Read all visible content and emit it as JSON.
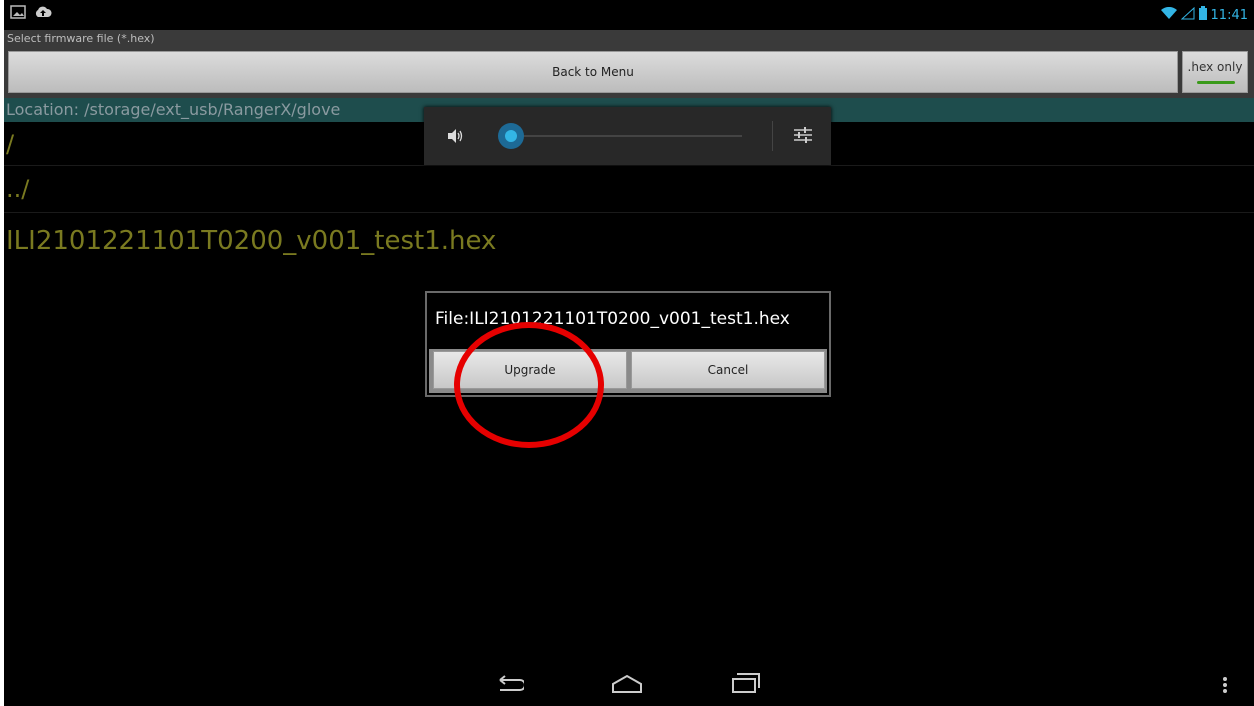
{
  "status_bar": {
    "time": "11:41",
    "left_icons": [
      "gallery-icon",
      "cloud-upload-icon"
    ],
    "right_icons": [
      "wifi-icon",
      "signal-icon",
      "battery-icon"
    ],
    "accent_color": "#33b5e5"
  },
  "app": {
    "title": "Select firmware file (*.hex)",
    "back_label": "Back to Menu",
    "hex_only_label": ".hex only",
    "location": "Location: /storage/ext_usb/RangerX/glove"
  },
  "file_list": [
    {
      "name": "/"
    },
    {
      "name": "../"
    },
    {
      "name": "ILI2101221101T0200_v001_test1.hex"
    }
  ],
  "volume_panel": {
    "level": 0.05,
    "icons": [
      "speaker-icon",
      "settings-sliders-icon"
    ]
  },
  "dialog": {
    "title": "File:ILI2101221101T0200_v001_test1.hex",
    "upgrade_label": "Upgrade",
    "cancel_label": "Cancel"
  },
  "annotation": {
    "color": "#e60000"
  },
  "nav": {
    "icons": [
      "back-icon",
      "home-icon",
      "recents-icon",
      "overflow-menu-icon"
    ]
  }
}
